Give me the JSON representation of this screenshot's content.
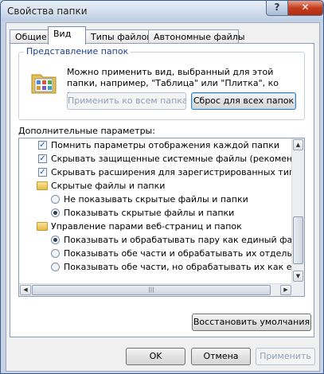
{
  "window": {
    "title": "Свойства папки",
    "help_label": "?",
    "close_label": "✕"
  },
  "tabs": [
    {
      "label": "Общие",
      "active": false
    },
    {
      "label": "Вид",
      "active": true
    },
    {
      "label": "Типы файлов",
      "active": false
    },
    {
      "label": "Автономные файлы",
      "active": false
    }
  ],
  "folder_view": {
    "legend": "Представление папок",
    "description": "Можно применить вид, выбранный для этой папки, например, \"Таблица\" или \"Плитка\", ко всем папкам.",
    "apply_all_label": "Применить ко всем папкам",
    "reset_all_label": "Сброс для всех папок"
  },
  "advanced": {
    "label": "Дополнительные параметры:",
    "items": [
      {
        "kind": "checkbox",
        "checked": true,
        "label": "Помнить параметры отображения каждой папки"
      },
      {
        "kind": "checkbox",
        "checked": true,
        "label": "Скрывать защищенные системные файлы (рекомендуется)"
      },
      {
        "kind": "checkbox",
        "checked": true,
        "label": "Скрывать расширения для зарегистрированных типов файлов"
      },
      {
        "kind": "folder",
        "label": "Скрытые файлы и папки"
      },
      {
        "kind": "radio",
        "checked": false,
        "label": "Не показывать скрытые файлы и папки"
      },
      {
        "kind": "radio",
        "checked": true,
        "label": "Показывать скрытые файлы и папки"
      },
      {
        "kind": "folder",
        "label": "Управление парами веб-страниц и папок"
      },
      {
        "kind": "radio",
        "checked": true,
        "label": "Показывать и обрабатывать пару как единый файл"
      },
      {
        "kind": "radio",
        "checked": false,
        "label": "Показывать обе части и обрабатывать их отдельно"
      },
      {
        "kind": "radio",
        "checked": false,
        "label": "Показывать обе части, но обрабатывать их как единый"
      }
    ],
    "scroll_up": "▲",
    "scroll_down": "▼",
    "scroll_left": "◀",
    "scroll_right": "▶",
    "grip": "|||"
  },
  "buttons": {
    "restore_defaults": "Восстановить умолчания",
    "ok": "OK",
    "cancel": "Отмена",
    "apply": "Применить"
  }
}
